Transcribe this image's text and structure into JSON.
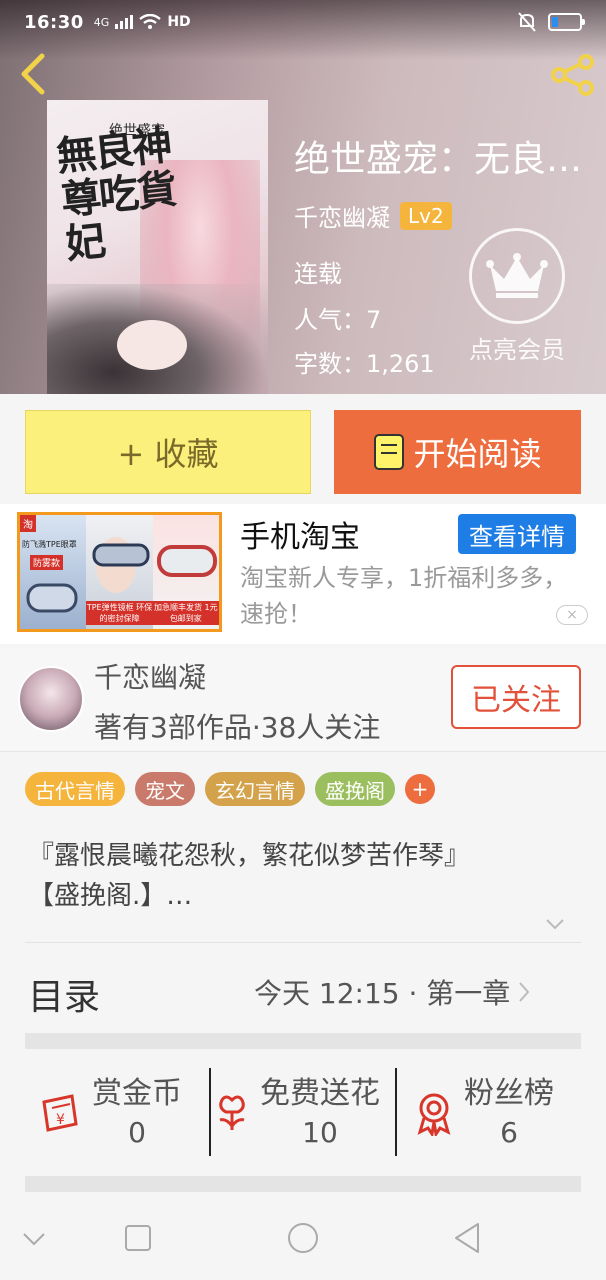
{
  "status_bar": {
    "time": "16:30",
    "network": "4G",
    "hd": "HD"
  },
  "book": {
    "title": "绝世盛宠：无良神尊吃货妃",
    "title_display": "绝世盛宠：无良…",
    "cover_title": "無良神尊吃貨妃",
    "cover_subtitle": "绝世盛宠",
    "author": "千恋幽凝",
    "level": "Lv2",
    "status": "连载",
    "popularity": "人气：7",
    "word_count": "字数：1,261"
  },
  "vip": {
    "label": "点亮会员"
  },
  "actions": {
    "favorite_label": "+ 收藏",
    "read_label": "开始阅读"
  },
  "ad": {
    "title": "手机淘宝",
    "detail_label": "查看详情",
    "description": "淘宝新人专享，1折福利多多，速抢！",
    "badge": "淘",
    "panel1_text": "防飞溅TPE眼罩",
    "panel1_tag": "防雾款",
    "panel2_tag": "TPE弹性镜框 环保的密封保障",
    "panel3_tag": "加急顺丰发货 1元包邮到家",
    "close_icon": "×"
  },
  "author_card": {
    "name": "千恋幽凝",
    "stats": "著有3部作品·38人关注",
    "follow_label": "已关注"
  },
  "tags": [
    {
      "label": "古代言情",
      "color": "#f5b43c"
    },
    {
      "label": "宠文",
      "color": "#c97a6a"
    },
    {
      "label": "玄幻言情",
      "color": "#d4a24a"
    },
    {
      "label": "盛挽阁",
      "color": "#9bbf5e"
    }
  ],
  "tag_add_label": "+",
  "intro": {
    "line1": "『露恨晨曦花怨秋，繁花似梦苦作琴』",
    "line2": "【盛挽阁.】…"
  },
  "toc": {
    "label": "目录",
    "latest": "今天 12:15 · 第一章"
  },
  "rewards": [
    {
      "label": "赏金币",
      "value": "0",
      "icon": "red-envelope-icon"
    },
    {
      "label": "免费送花",
      "value": "10",
      "icon": "flower-icon"
    },
    {
      "label": "粉丝榜",
      "value": "6",
      "icon": "medal-icon"
    }
  ],
  "colors": {
    "accent_orange": "#ed6d3f",
    "favorite_yellow": "#fbf07c",
    "ad_blue": "#1e7ee5",
    "follow_red": "#e2513a",
    "level_badge": "#f5b43c"
  }
}
